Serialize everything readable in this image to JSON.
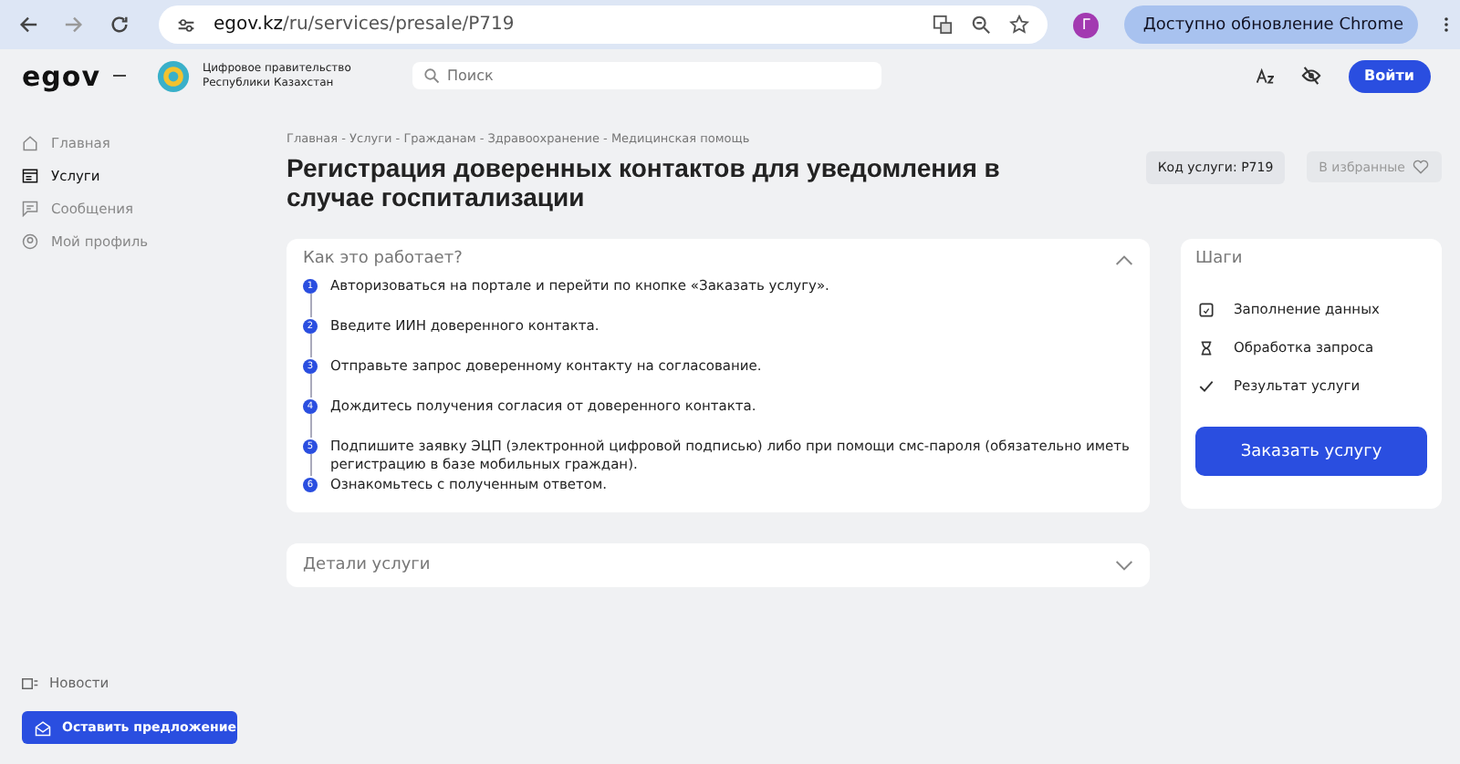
{
  "browser": {
    "url_domain": "egov.kz",
    "url_path": "/ru/services/presale/P719",
    "profile_initial": "Г",
    "update_button": "Доступно обновление Chrome"
  },
  "header": {
    "logo": "egov",
    "brand_line1": "Цифровое правительство",
    "brand_line2": "Республики Казахстан",
    "search": {
      "placeholder": "Поиск"
    },
    "login_button": "Войти"
  },
  "sidebar": {
    "items": [
      {
        "label": "Главная",
        "kind": "home",
        "selected": false
      },
      {
        "label": "Услуги",
        "kind": "services",
        "selected": true
      },
      {
        "label": "Сообщения",
        "kind": "message",
        "selected": false
      },
      {
        "label": "Мой профиль",
        "kind": "profile",
        "selected": false
      }
    ],
    "news": "Новости",
    "suggest_button": "Оставить предложение"
  },
  "breadcrumb": "Главная - Услуги - Гражданам - Здравоохранение - Медицинская помощь",
  "title": "Регистрация доверенных контактов для уведомления в случае госпитализации",
  "service_code": "Код услуги: P719",
  "favorite_button": "В избранные",
  "how_it_works": {
    "title": "Как это работает?",
    "expanded": true,
    "steps": [
      {
        "number": "1",
        "text": "Авторизоваться на портале и перейти по кнопке «Заказать услугу»."
      },
      {
        "number": "2",
        "text": "Введите ИИН доверенного контакта."
      },
      {
        "number": "3",
        "text": "Отправьте запрос доверенному контакту на согласование."
      },
      {
        "number": "4",
        "text": "Дождитесь получения согласия от доверенного контакта."
      },
      {
        "number": "5",
        "text": "Подпишите заявку ЭЦП (электронной цифровой подписью) либо при помощи смс-пароля (обязательно иметь регистрацию в базе мобильных граждан)."
      },
      {
        "number": "6",
        "text": "Ознакомьтесь с полученным ответом."
      }
    ]
  },
  "details": {
    "title": "Детали услуги",
    "expanded": false
  },
  "steps_panel": {
    "title": "Шаги",
    "steps": [
      {
        "kind": "form",
        "label": "Заполнение данных"
      },
      {
        "kind": "hourglass",
        "label": "Обработка запроса"
      },
      {
        "kind": "check",
        "label": "Результат услуги"
      }
    ],
    "order_button": "Заказать услугу"
  }
}
